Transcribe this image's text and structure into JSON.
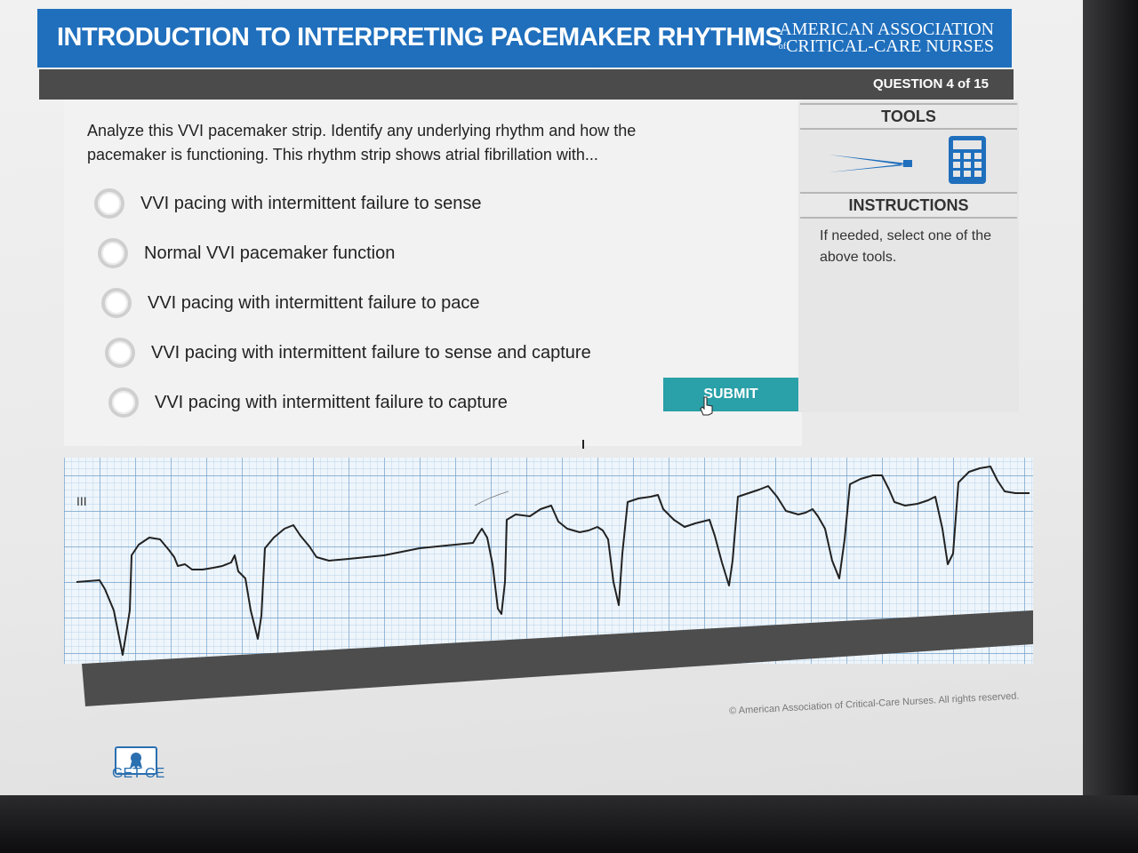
{
  "header": {
    "course_title": "INTRODUCTION TO INTERPRETING PACEMAKER RHYTHMS",
    "org_line1": "AMERICAN ASSOCIATION",
    "org_line2_prefix": "of",
    "org_line2": "CRITICAL-CARE NURSES"
  },
  "question": {
    "counter": "QUESTION 4 of 15",
    "text": "Analyze this VVI pacemaker strip. Identify any underlying rhythm and how the pacemaker is functioning. This rhythm strip shows atrial fibrillation with...",
    "options": [
      {
        "label": "VVI pacing with intermittent failure to sense",
        "selected": false
      },
      {
        "label": "Normal VVI pacemaker function",
        "selected": false
      },
      {
        "label": "VVI pacing with intermittent failure to pace",
        "selected": false
      },
      {
        "label": "VVI pacing with intermittent failure to sense and capture",
        "selected": false
      },
      {
        "label": "VVI pacing with intermittent failure to capture",
        "selected": false
      }
    ],
    "submit_label": "SUBMIT"
  },
  "sidebar": {
    "tools_heading": "TOOLS",
    "tools": [
      "calipers-icon",
      "calculator-icon"
    ],
    "instructions_heading": "INSTRUCTIONS",
    "instructions_text": "If needed, select one of the above tools."
  },
  "strip": {
    "lead_label": "III"
  },
  "footer": {
    "copyright": "© American Association of Critical-Care Nurses. All rights reserved.",
    "get_ce_label": "GET CE"
  },
  "colors": {
    "header_blue": "#1f6fbd",
    "submit_teal": "#2aa0a8",
    "grid_blue": "#8fb7d8"
  }
}
